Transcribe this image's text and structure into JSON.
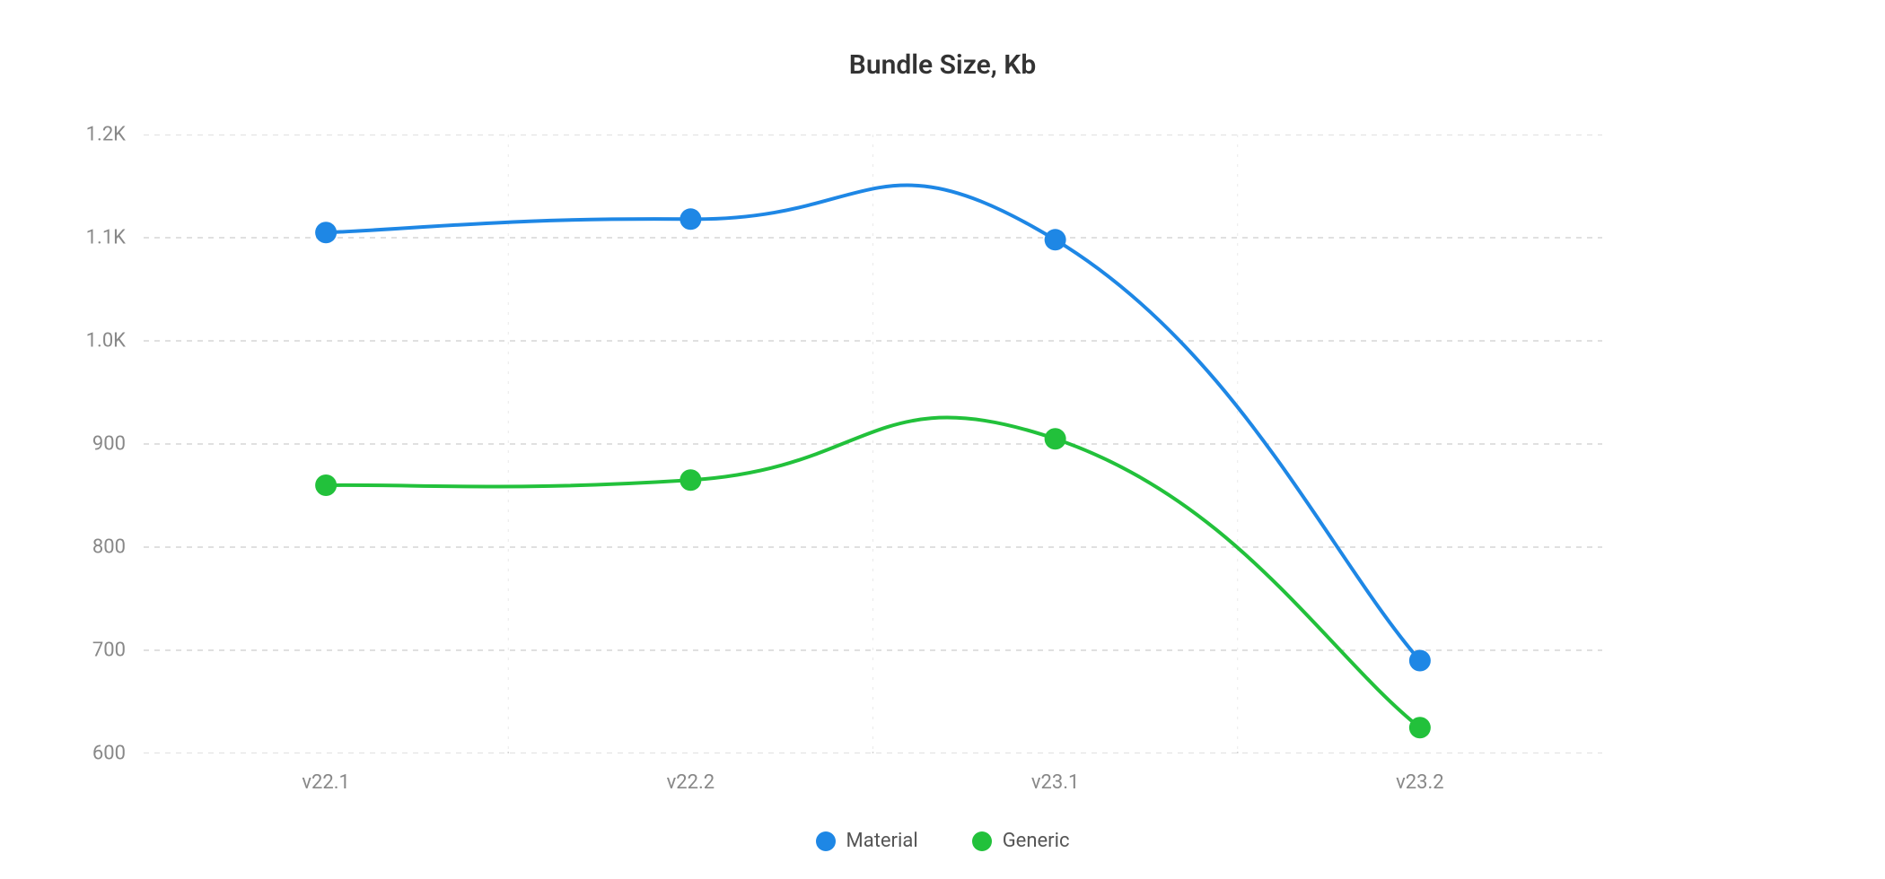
{
  "chart_data": {
    "type": "line",
    "title": "Bundle Size, Kb",
    "xlabel": "",
    "ylabel": "",
    "categories": [
      "v22.1",
      "v22.2",
      "v23.1",
      "v23.2"
    ],
    "series": [
      {
        "name": "Material",
        "color": "#1e87e5",
        "values": [
          1105,
          1118,
          1098,
          690
        ]
      },
      {
        "name": "Generic",
        "color": "#22c13b",
        "values": [
          860,
          865,
          905,
          625
        ]
      }
    ],
    "ylim": [
      600,
      1200
    ],
    "y_ticks": [
      600,
      700,
      800,
      900,
      1000,
      1100,
      1200
    ],
    "y_tick_labels": [
      "600",
      "700",
      "800",
      "900",
      "1.0K",
      "1.1K",
      "1.2K"
    ],
    "legend_position": "bottom",
    "grid": true
  }
}
